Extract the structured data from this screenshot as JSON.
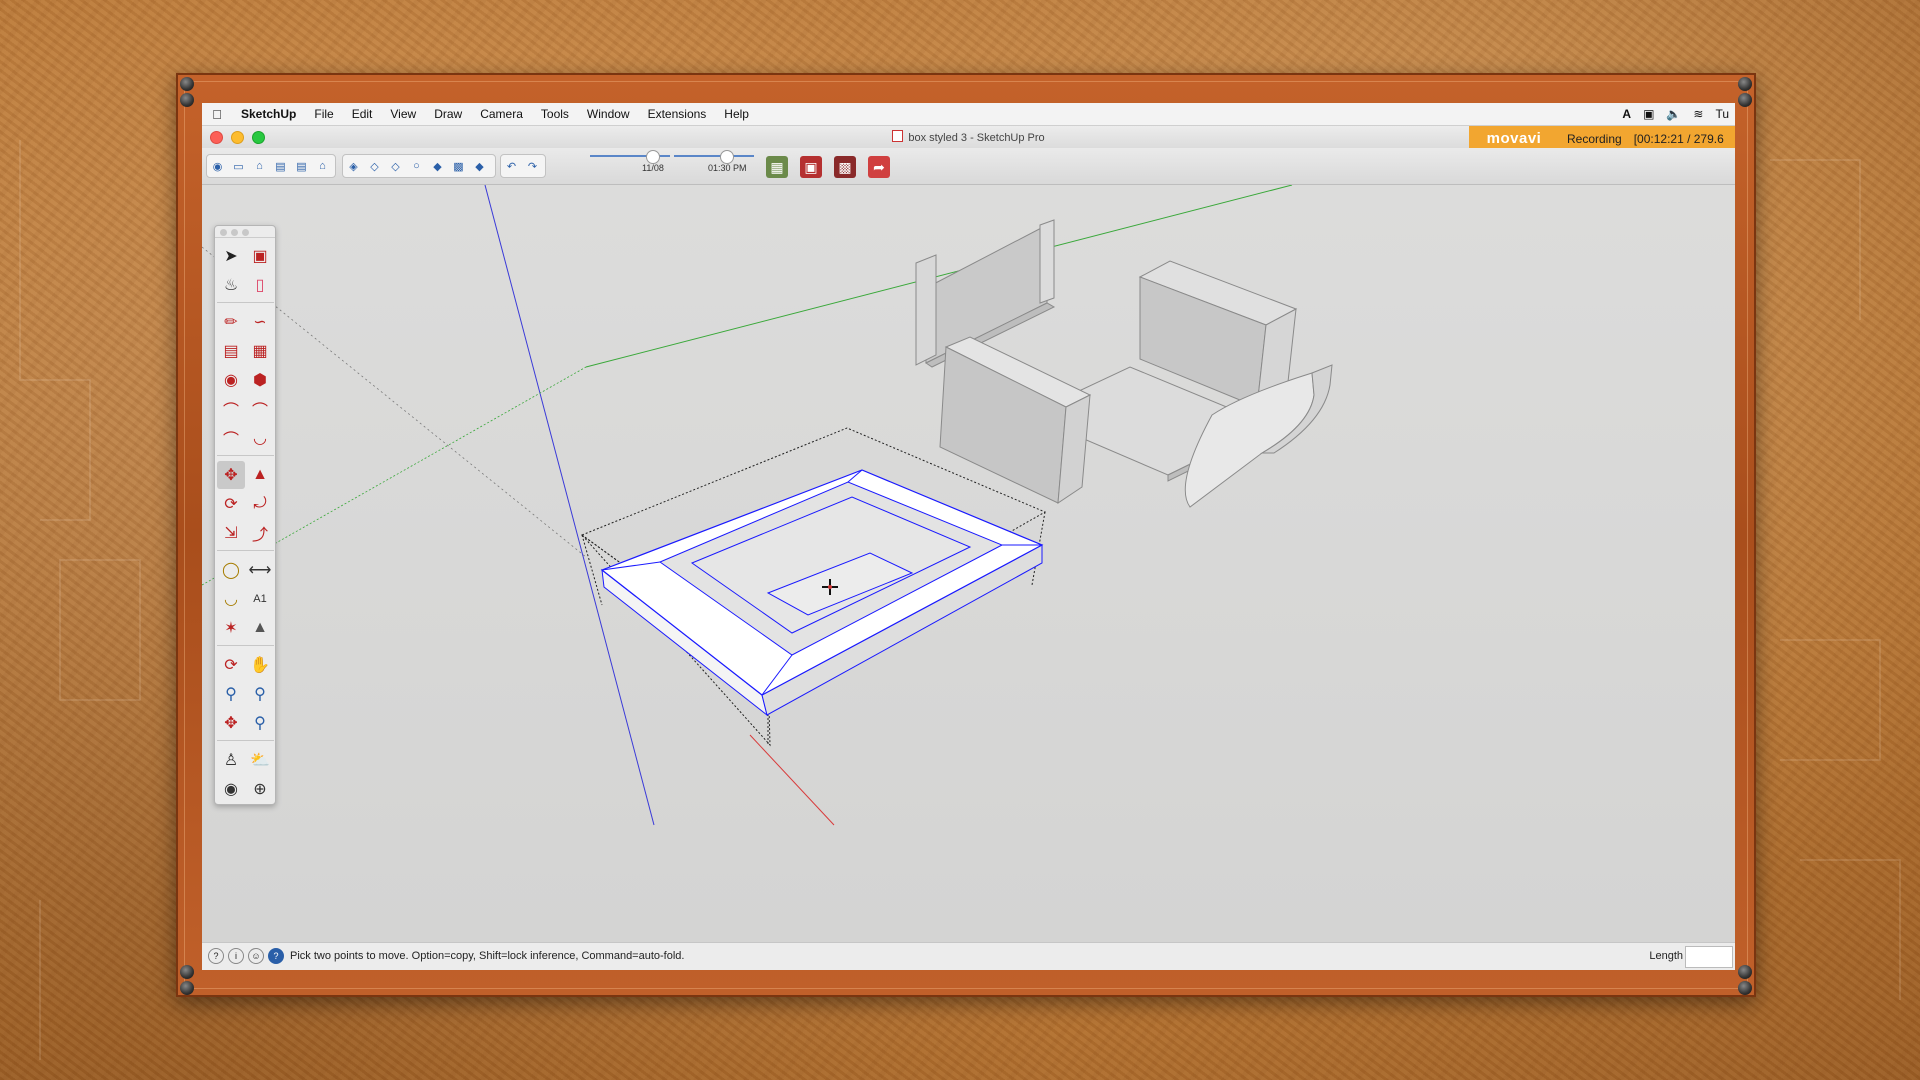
{
  "menubar": {
    "apple": "",
    "app": "SketchUp",
    "items": [
      "File",
      "Edit",
      "View",
      "Draw",
      "Camera",
      "Tools",
      "Window",
      "Extensions",
      "Help"
    ],
    "clock": "Tu"
  },
  "window": {
    "title": "box styled 3 - SketchUp Pro"
  },
  "recorder": {
    "logo": "movavi",
    "status": "Recording",
    "timer": "[00:12:21 / 279.6"
  },
  "shadow": {
    "date_label": "11/08",
    "time_label": "01:30 PM"
  },
  "status": {
    "message": "Pick two points to move.  Option=copy, Shift=lock inference, Command=auto-fold.",
    "length_label": "Length",
    "length_value": ""
  },
  "icons": {
    "toolbar_left": [
      "orbit-view-icon",
      "iso-view-icon",
      "home-view-icon",
      "top-view-icon",
      "front-view-icon",
      "right-view-icon"
    ],
    "toolbar_styles": [
      "xray-style-icon",
      "backedges-style-icon",
      "wireframe-style-icon",
      "hiddenline-style-icon",
      "shaded-style-icon",
      "textured-style-icon",
      "monochrome-style-icon"
    ],
    "toolbar_undo": [
      "undo-icon",
      "redo-icon"
    ],
    "toolbar_right": [
      "map-icon",
      "warehouse-icon",
      "extension-warehouse-icon",
      "layout-send-icon"
    ]
  },
  "colors": {
    "selection": "#1a1aff",
    "axis_red": "#d83a3a",
    "axis_green": "#3aa83a",
    "axis_blue": "#3a3ad8",
    "recorder_bg": "#f2a630"
  }
}
